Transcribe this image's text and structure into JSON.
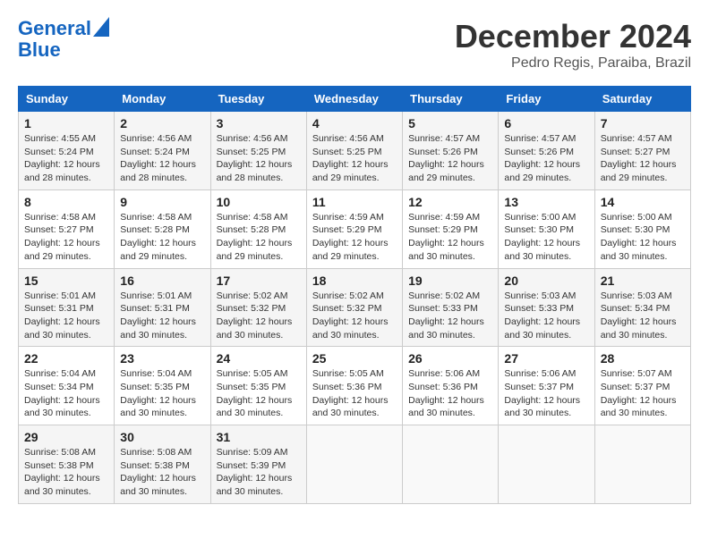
{
  "logo": {
    "line1": "General",
    "line2": "Blue"
  },
  "title": "December 2024",
  "subtitle": "Pedro Regis, Paraiba, Brazil",
  "days_of_week": [
    "Sunday",
    "Monday",
    "Tuesday",
    "Wednesday",
    "Thursday",
    "Friday",
    "Saturday"
  ],
  "weeks": [
    [
      {
        "day": "1",
        "detail": "Sunrise: 4:55 AM\nSunset: 5:24 PM\nDaylight: 12 hours\nand 28 minutes."
      },
      {
        "day": "2",
        "detail": "Sunrise: 4:56 AM\nSunset: 5:24 PM\nDaylight: 12 hours\nand 28 minutes."
      },
      {
        "day": "3",
        "detail": "Sunrise: 4:56 AM\nSunset: 5:25 PM\nDaylight: 12 hours\nand 28 minutes."
      },
      {
        "day": "4",
        "detail": "Sunrise: 4:56 AM\nSunset: 5:25 PM\nDaylight: 12 hours\nand 29 minutes."
      },
      {
        "day": "5",
        "detail": "Sunrise: 4:57 AM\nSunset: 5:26 PM\nDaylight: 12 hours\nand 29 minutes."
      },
      {
        "day": "6",
        "detail": "Sunrise: 4:57 AM\nSunset: 5:26 PM\nDaylight: 12 hours\nand 29 minutes."
      },
      {
        "day": "7",
        "detail": "Sunrise: 4:57 AM\nSunset: 5:27 PM\nDaylight: 12 hours\nand 29 minutes."
      }
    ],
    [
      {
        "day": "8",
        "detail": "Sunrise: 4:58 AM\nSunset: 5:27 PM\nDaylight: 12 hours\nand 29 minutes."
      },
      {
        "day": "9",
        "detail": "Sunrise: 4:58 AM\nSunset: 5:28 PM\nDaylight: 12 hours\nand 29 minutes."
      },
      {
        "day": "10",
        "detail": "Sunrise: 4:58 AM\nSunset: 5:28 PM\nDaylight: 12 hours\nand 29 minutes."
      },
      {
        "day": "11",
        "detail": "Sunrise: 4:59 AM\nSunset: 5:29 PM\nDaylight: 12 hours\nand 29 minutes."
      },
      {
        "day": "12",
        "detail": "Sunrise: 4:59 AM\nSunset: 5:29 PM\nDaylight: 12 hours\nand 30 minutes."
      },
      {
        "day": "13",
        "detail": "Sunrise: 5:00 AM\nSunset: 5:30 PM\nDaylight: 12 hours\nand 30 minutes."
      },
      {
        "day": "14",
        "detail": "Sunrise: 5:00 AM\nSunset: 5:30 PM\nDaylight: 12 hours\nand 30 minutes."
      }
    ],
    [
      {
        "day": "15",
        "detail": "Sunrise: 5:01 AM\nSunset: 5:31 PM\nDaylight: 12 hours\nand 30 minutes."
      },
      {
        "day": "16",
        "detail": "Sunrise: 5:01 AM\nSunset: 5:31 PM\nDaylight: 12 hours\nand 30 minutes."
      },
      {
        "day": "17",
        "detail": "Sunrise: 5:02 AM\nSunset: 5:32 PM\nDaylight: 12 hours\nand 30 minutes."
      },
      {
        "day": "18",
        "detail": "Sunrise: 5:02 AM\nSunset: 5:32 PM\nDaylight: 12 hours\nand 30 minutes."
      },
      {
        "day": "19",
        "detail": "Sunrise: 5:02 AM\nSunset: 5:33 PM\nDaylight: 12 hours\nand 30 minutes."
      },
      {
        "day": "20",
        "detail": "Sunrise: 5:03 AM\nSunset: 5:33 PM\nDaylight: 12 hours\nand 30 minutes."
      },
      {
        "day": "21",
        "detail": "Sunrise: 5:03 AM\nSunset: 5:34 PM\nDaylight: 12 hours\nand 30 minutes."
      }
    ],
    [
      {
        "day": "22",
        "detail": "Sunrise: 5:04 AM\nSunset: 5:34 PM\nDaylight: 12 hours\nand 30 minutes."
      },
      {
        "day": "23",
        "detail": "Sunrise: 5:04 AM\nSunset: 5:35 PM\nDaylight: 12 hours\nand 30 minutes."
      },
      {
        "day": "24",
        "detail": "Sunrise: 5:05 AM\nSunset: 5:35 PM\nDaylight: 12 hours\nand 30 minutes."
      },
      {
        "day": "25",
        "detail": "Sunrise: 5:05 AM\nSunset: 5:36 PM\nDaylight: 12 hours\nand 30 minutes."
      },
      {
        "day": "26",
        "detail": "Sunrise: 5:06 AM\nSunset: 5:36 PM\nDaylight: 12 hours\nand 30 minutes."
      },
      {
        "day": "27",
        "detail": "Sunrise: 5:06 AM\nSunset: 5:37 PM\nDaylight: 12 hours\nand 30 minutes."
      },
      {
        "day": "28",
        "detail": "Sunrise: 5:07 AM\nSunset: 5:37 PM\nDaylight: 12 hours\nand 30 minutes."
      }
    ],
    [
      {
        "day": "29",
        "detail": "Sunrise: 5:08 AM\nSunset: 5:38 PM\nDaylight: 12 hours\nand 30 minutes."
      },
      {
        "day": "30",
        "detail": "Sunrise: 5:08 AM\nSunset: 5:38 PM\nDaylight: 12 hours\nand 30 minutes."
      },
      {
        "day": "31",
        "detail": "Sunrise: 5:09 AM\nSunset: 5:39 PM\nDaylight: 12 hours\nand 30 minutes."
      },
      null,
      null,
      null,
      null
    ]
  ]
}
